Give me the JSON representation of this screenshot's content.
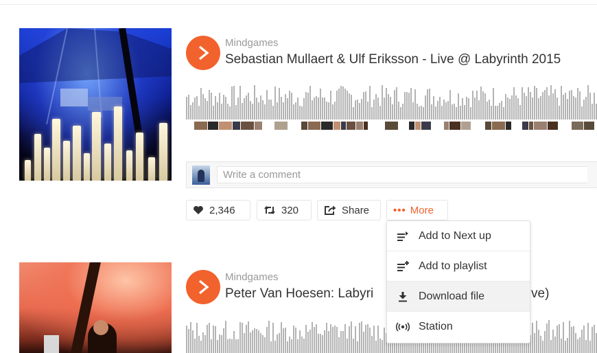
{
  "tracks": [
    {
      "user": "Mindgames",
      "title": "Sebastian Mullaert & Ulf Eriksson - Live @ Labyrinth 2015"
    },
    {
      "user": "Mindgames",
      "title": "Peter Van Hoesen: Labyri",
      "title_suffix": "ve)"
    }
  ],
  "comment": {
    "placeholder": "Write a comment"
  },
  "actions": {
    "likes": "2,346",
    "reposts": "320",
    "share_label": "Share",
    "more_label": "More"
  },
  "more_menu": {
    "items": [
      {
        "label": "Add to Next up",
        "icon": "add-to-next-up-icon"
      },
      {
        "label": "Add to playlist",
        "icon": "add-to-playlist-icon"
      },
      {
        "label": "Download file",
        "icon": "download-icon"
      },
      {
        "label": "Station",
        "icon": "station-icon"
      }
    ]
  },
  "colors": {
    "accent": "#f2622c",
    "waveform": "#b3b3b3",
    "text": "#333333",
    "muted": "#999999"
  }
}
